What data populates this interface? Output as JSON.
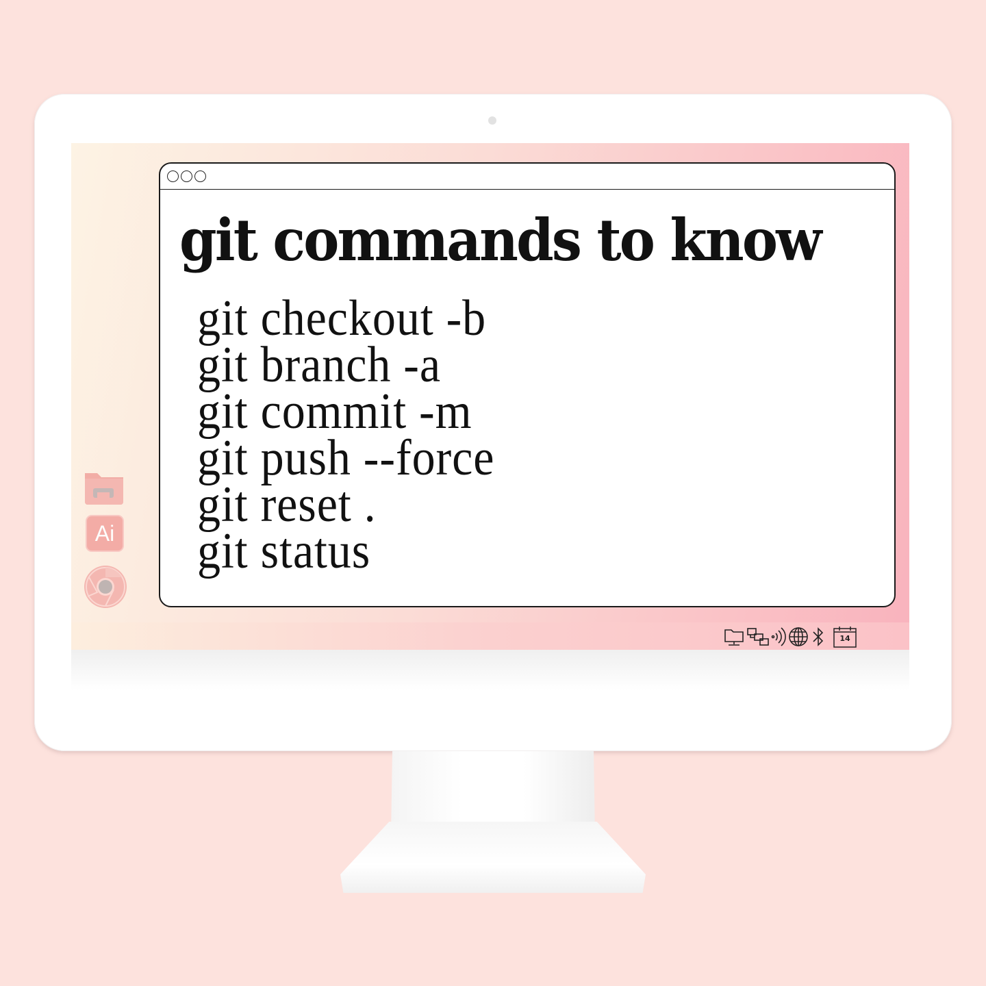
{
  "window": {
    "heading": "git commands to know",
    "commands": [
      "git checkout -b",
      "git branch -a",
      "git commit -m",
      "git push --force",
      "git reset .",
      "git status"
    ]
  },
  "dock": {
    "items": [
      {
        "name": "folder-icon"
      },
      {
        "name": "illustrator-icon",
        "label": "Ai"
      },
      {
        "name": "chrome-icon"
      }
    ]
  },
  "taskbar": {
    "tray_icons": [
      "folder-network-icon",
      "network-icon",
      "wireless-icon",
      "globe-icon",
      "bluetooth-icon",
      "calendar-icon"
    ],
    "calendar_day": "14"
  },
  "colors": {
    "page_background": "#fde2dd",
    "accent_pink": "#f9b3bd",
    "window_border": "#1a1a1a"
  }
}
